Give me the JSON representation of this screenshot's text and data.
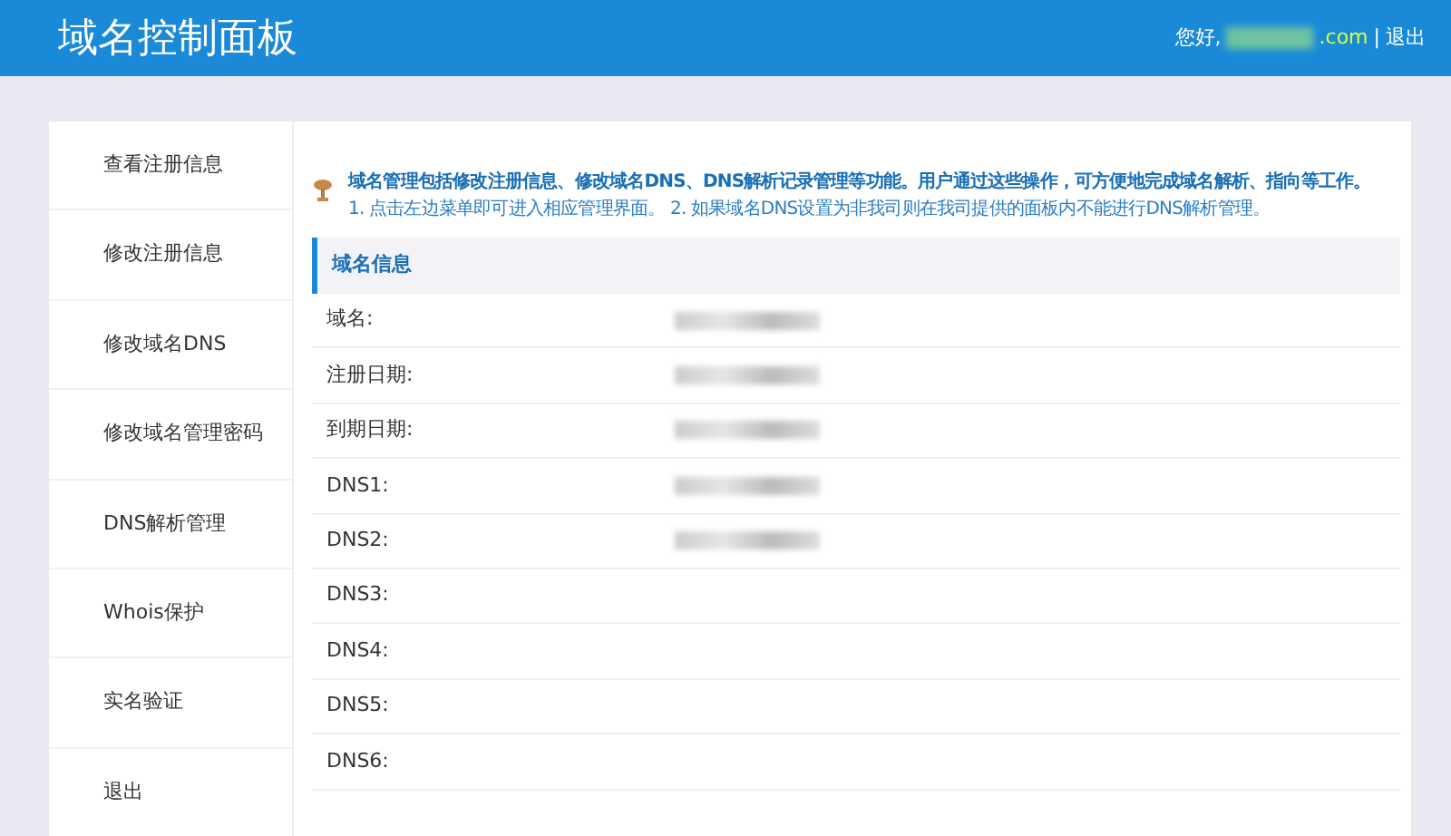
{
  "header": {
    "title": "域名控制面板",
    "greeting": "您好,",
    "domain_suffix": ".com",
    "separator": "|",
    "logout": "退出"
  },
  "sidebar": {
    "items": [
      {
        "label": "查看注册信息"
      },
      {
        "label": "修改注册信息"
      },
      {
        "label": "修改域名DNS"
      },
      {
        "label": "修改域名管理密码"
      },
      {
        "label": "DNS解析管理"
      },
      {
        "label": "Whois保护"
      },
      {
        "label": "实名验证"
      },
      {
        "label": "退出"
      }
    ]
  },
  "notice": {
    "headline": "域名管理包括修改注册信息、修改域名DNS、DNS解析记录管理等功能。用户通过这些操作，可方便地完成域名解析、指向等工作。",
    "detail": "1. 点击左边菜单即可进入相应管理界面。 2. 如果域名DNS设置为非我司则在我司提供的面板内不能进行DNS解析管理。"
  },
  "domain_info": {
    "title": "域名信息",
    "rows": [
      {
        "label": "域名:",
        "redacted": true
      },
      {
        "label": "注册日期:",
        "redacted": true
      },
      {
        "label": "到期日期:",
        "redacted": true
      },
      {
        "label": "DNS1:",
        "redacted": true
      },
      {
        "label": "DNS2:",
        "redacted": true
      },
      {
        "label": "DNS3:",
        "redacted": false
      },
      {
        "label": "DNS4:",
        "redacted": false
      },
      {
        "label": "DNS5:",
        "redacted": false
      },
      {
        "label": "DNS6:",
        "redacted": false
      }
    ]
  }
}
